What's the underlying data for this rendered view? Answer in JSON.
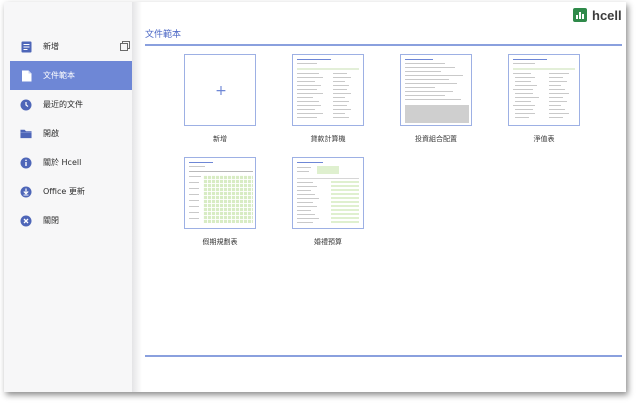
{
  "brand": {
    "name": "hcell",
    "color": "#2f8a4a"
  },
  "accent": "#6e87d6",
  "sidebar": {
    "items": [
      {
        "label": "新增",
        "icon": "new-document-icon",
        "active": false
      },
      {
        "label": "文件範本",
        "icon": "template-icon",
        "active": true
      },
      {
        "label": "最近的文件",
        "icon": "clock-icon",
        "active": false
      },
      {
        "label": "開啟",
        "icon": "folder-icon",
        "active": false
      },
      {
        "label": "關於 Hcell",
        "icon": "info-icon",
        "active": false
      },
      {
        "label": "Office 更新",
        "icon": "download-icon",
        "active": false
      },
      {
        "label": "關閉",
        "icon": "close-icon",
        "active": false
      }
    ]
  },
  "main": {
    "title": "文件範本",
    "templates": [
      {
        "label": "新增"
      },
      {
        "label": "貸款計算機"
      },
      {
        "label": "投資組合配置"
      },
      {
        "label": "淨值表"
      },
      {
        "label": "假期規劃表"
      },
      {
        "label": "婚禮預算"
      }
    ]
  }
}
